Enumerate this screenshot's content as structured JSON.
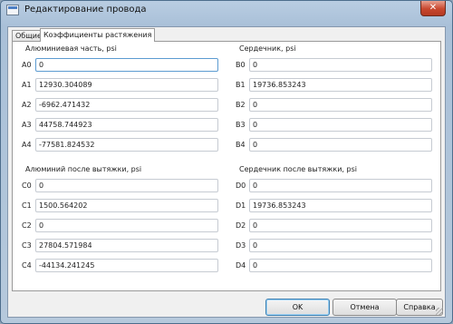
{
  "window": {
    "title": "Редактирование провода",
    "close_glyph": "✕"
  },
  "tabs": [
    {
      "label": "Общие",
      "active": false
    },
    {
      "label": "Коэффициенты растяжения",
      "active": true
    }
  ],
  "groups": {
    "aluminum": {
      "title": "Алюминиевая часть, psi",
      "rows": [
        {
          "label": "A0",
          "value": "0"
        },
        {
          "label": "A1",
          "value": "12930.304089"
        },
        {
          "label": "A2",
          "value": "-6962.471432"
        },
        {
          "label": "A3",
          "value": "44758.744923"
        },
        {
          "label": "A4",
          "value": "-77581.824532"
        }
      ]
    },
    "core": {
      "title": "Сердечник, psi",
      "rows": [
        {
          "label": "B0",
          "value": "0"
        },
        {
          "label": "B1",
          "value": "19736.853243"
        },
        {
          "label": "B2",
          "value": "0"
        },
        {
          "label": "B3",
          "value": "0"
        },
        {
          "label": "B4",
          "value": "0"
        }
      ]
    },
    "aluminum_after": {
      "title": "Алюминий после вытяжки, psi",
      "rows": [
        {
          "label": "C0",
          "value": "0"
        },
        {
          "label": "C1",
          "value": "1500.564202"
        },
        {
          "label": "C2",
          "value": "0"
        },
        {
          "label": "C3",
          "value": "27804.571984"
        },
        {
          "label": "C4",
          "value": "-44134.241245"
        }
      ]
    },
    "core_after": {
      "title": "Сердечник после вытяжки, psi",
      "rows": [
        {
          "label": "D0",
          "value": "0"
        },
        {
          "label": "D1",
          "value": "19736.853243"
        },
        {
          "label": "D2",
          "value": "0"
        },
        {
          "label": "D3",
          "value": "0"
        },
        {
          "label": "D4",
          "value": "0"
        }
      ]
    }
  },
  "buttons": {
    "ok": "OK",
    "cancel": "Отмена",
    "help": "Справка"
  }
}
